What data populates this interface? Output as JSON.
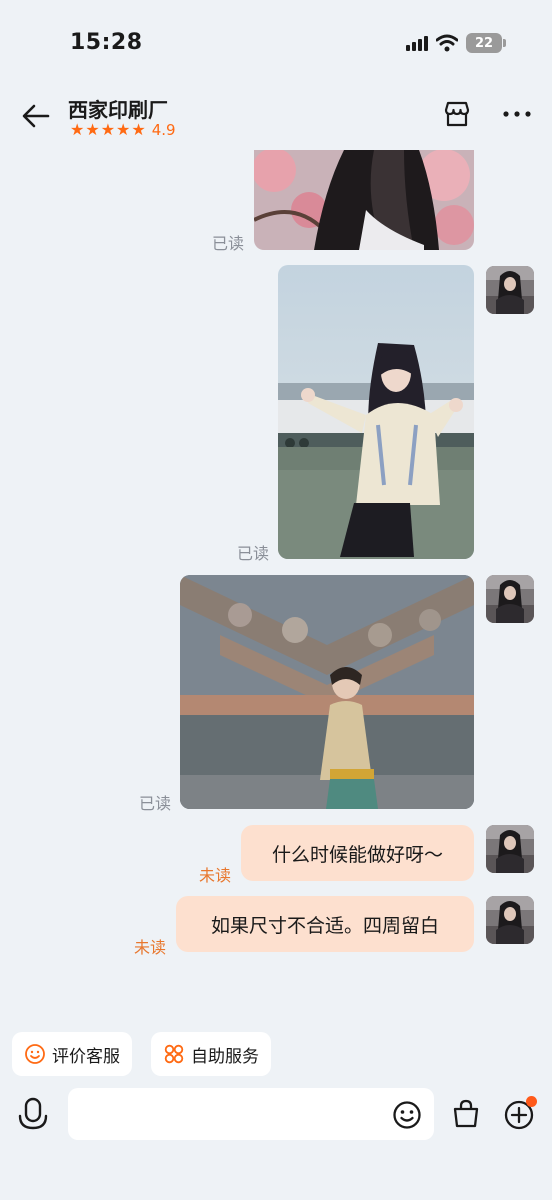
{
  "status_bar": {
    "time": "15:28",
    "battery": "22"
  },
  "header": {
    "title": "西家印刷厂",
    "rating": "4.9",
    "stars": 5
  },
  "messages": [
    {
      "type": "image",
      "alt": "cherry blossom portrait photo",
      "status": "已读"
    },
    {
      "type": "image",
      "alt": "girl by the harbor photo",
      "status": "已读"
    },
    {
      "type": "image",
      "alt": "temple wall portrait photo",
      "status": "已读"
    },
    {
      "type": "text",
      "text": "什么时候能做好呀～",
      "status": "未读"
    },
    {
      "type": "text",
      "text": "如果尺寸不合适。四周留白",
      "status": "未读"
    }
  ],
  "quick_actions": [
    {
      "label": "评价客服",
      "icon": "smiley-icon"
    },
    {
      "label": "自助服务",
      "icon": "grid-icon"
    }
  ],
  "input": {
    "placeholder": ""
  },
  "colors": {
    "accent": "#ff6a13",
    "bubble": "#fde0cf",
    "background": "#eef2f6",
    "read": "#8a8f98",
    "unread": "#e8772e"
  }
}
